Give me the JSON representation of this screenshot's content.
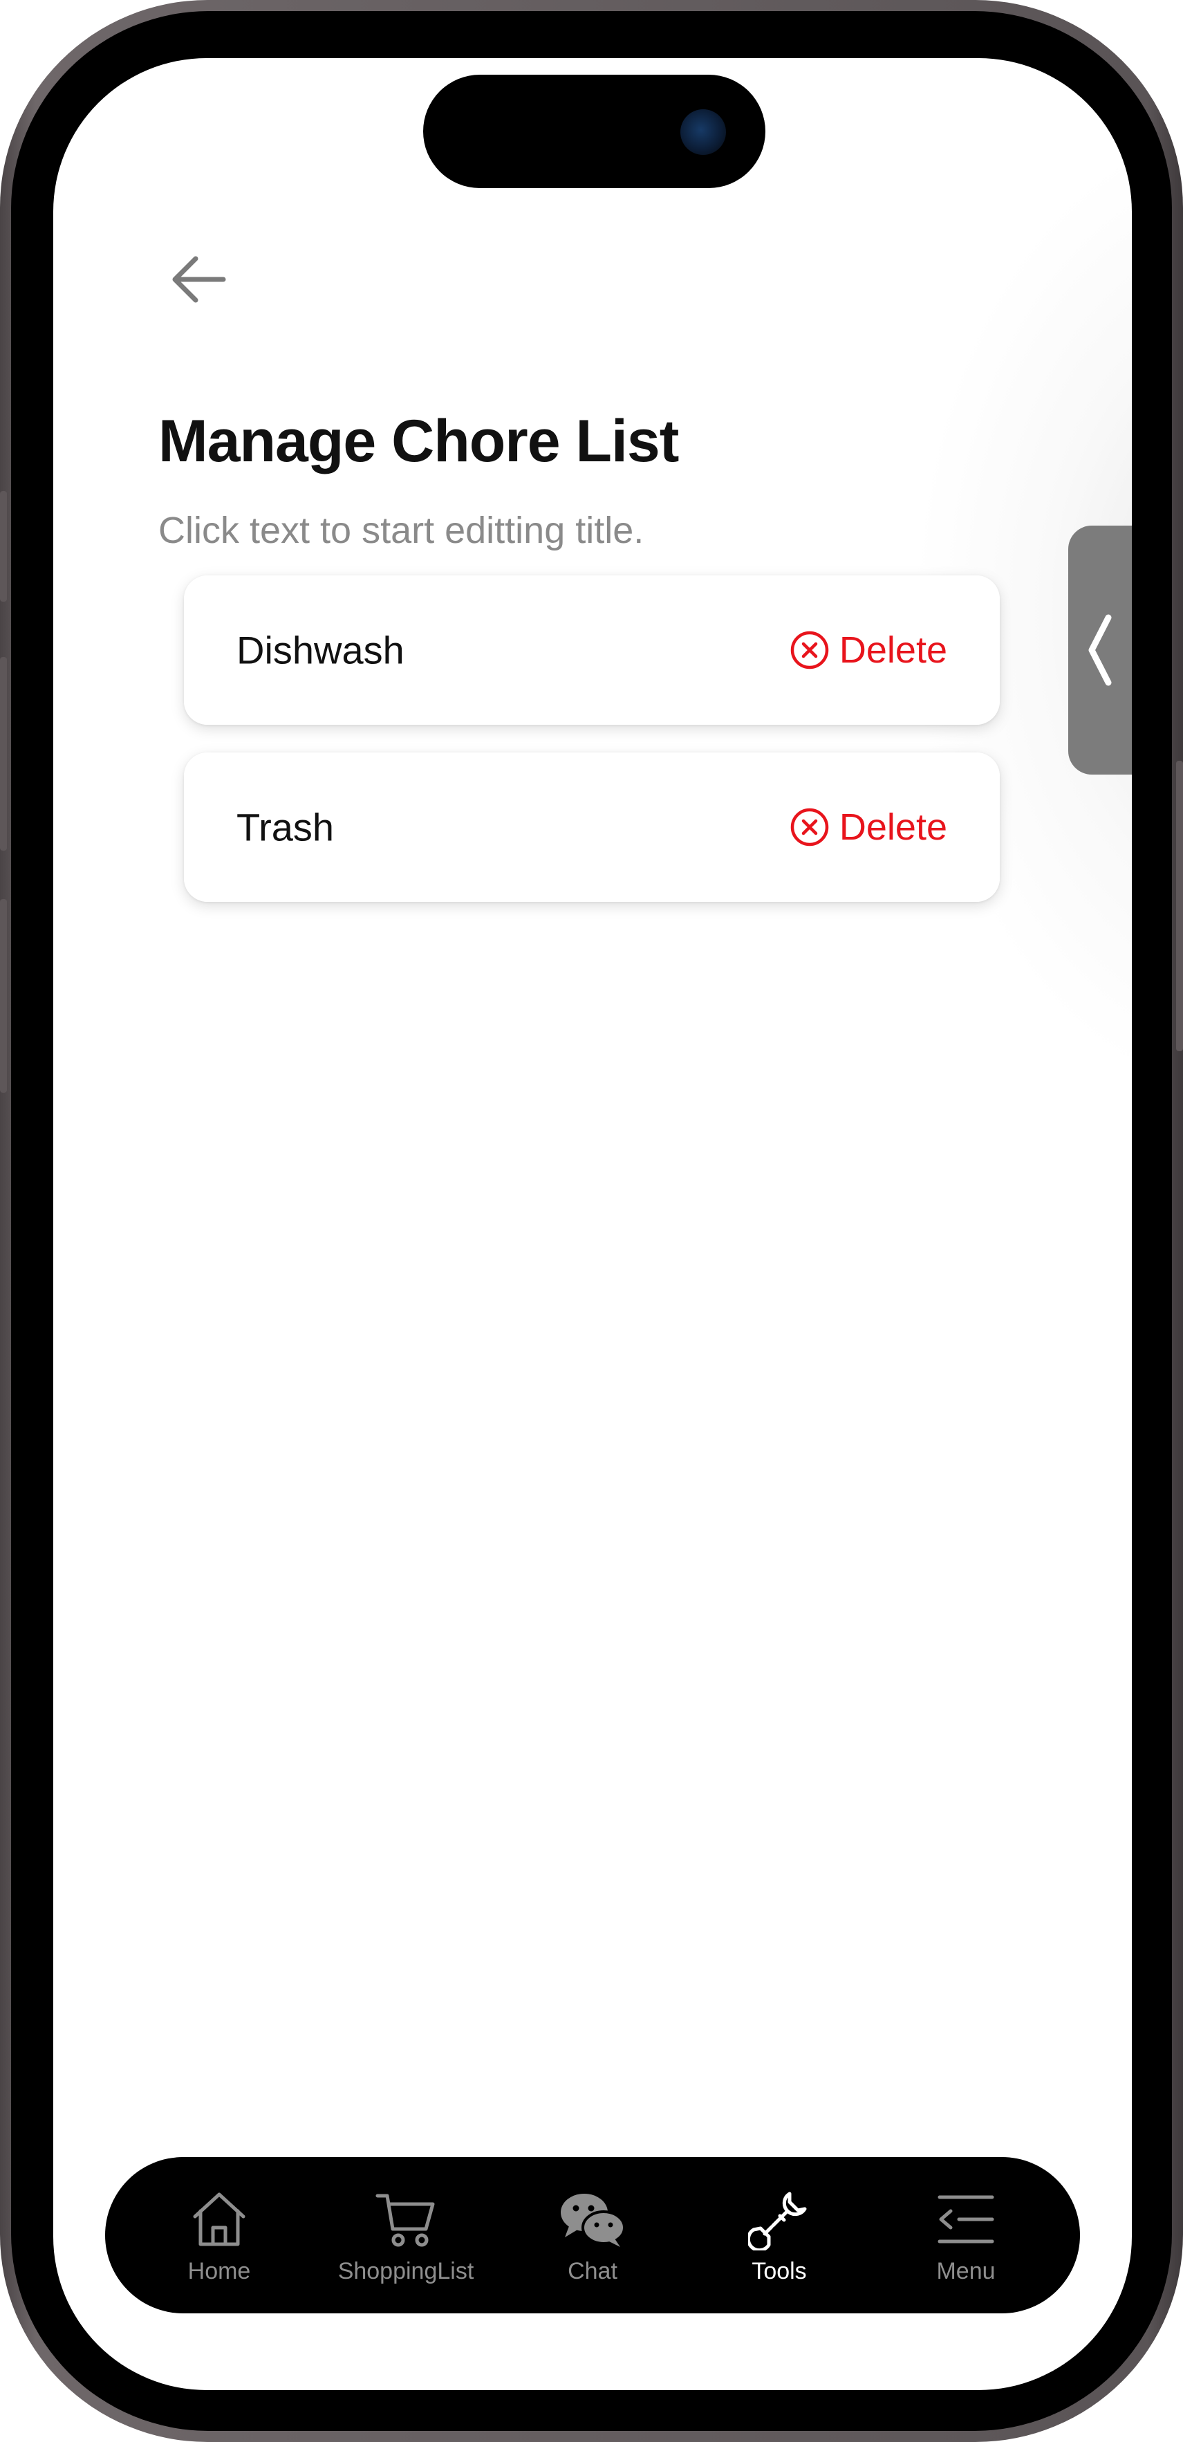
{
  "header": {
    "back_icon": "arrow-left-icon",
    "title": "Manage Chore List",
    "subtitle": "Click text to start editting title."
  },
  "chores": [
    {
      "name": "Dishwash",
      "delete_label": "Delete",
      "delete_icon": "circle-x-icon"
    },
    {
      "name": "Trash",
      "delete_label": "Delete",
      "delete_icon": "circle-x-icon"
    }
  ],
  "side_handle": {
    "icon": "chevron-left-icon"
  },
  "tabbar": {
    "tabs": [
      {
        "label": "Home",
        "icon": "home-icon",
        "active": false
      },
      {
        "label": "ShoppingList",
        "icon": "cart-icon",
        "active": false
      },
      {
        "label": "Chat",
        "icon": "chat-bubbles-icon",
        "active": false
      },
      {
        "label": "Tools",
        "icon": "wrench-icon",
        "active": true
      },
      {
        "label": "Menu",
        "icon": "menu-lines-icon",
        "active": false
      }
    ]
  },
  "colors": {
    "delete_red": "#e8141c",
    "title": "#111111",
    "subtitle": "#8a8a8a",
    "tab_inactive": "#8e8e8e",
    "tab_active": "#ffffff",
    "tabbar_bg": "#000000",
    "handle_bg": "#7c7c7c"
  }
}
